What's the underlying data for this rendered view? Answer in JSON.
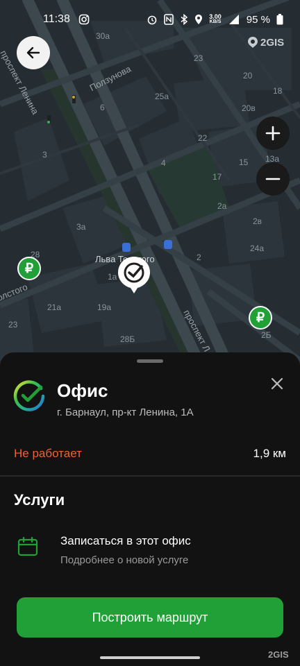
{
  "status_bar": {
    "time": "11:38",
    "network_speed": "3.00",
    "network_unit": "KB/S",
    "battery": "95 %"
  },
  "map": {
    "logo": "2GIS",
    "streets": [
      "проспект Ленина",
      "Ползунова",
      "Толстого",
      "проспект Л"
    ],
    "house_numbers": [
      "30а",
      "23",
      "20",
      "6",
      "25а",
      "20в",
      "18",
      "22",
      "13а",
      "3",
      "4",
      "15",
      "17",
      "2а",
      "3а",
      "2в",
      "24а",
      "28",
      "2",
      "1а",
      "21а",
      "19а",
      "23",
      "28Б",
      "2Б"
    ],
    "stop_label": "Льва Толстого",
    "atm_symbol": "₽"
  },
  "sheet": {
    "title": "Офис",
    "address": "г. Барнаул, пр-кт Ленина, 1А",
    "status": "Не работает",
    "distance": "1,9 км",
    "services_heading": "Услуги",
    "service_title": "Записаться в этот офис",
    "service_subtitle": "Подробнее о новой услуге",
    "route_button": "Построить маршрут",
    "watermark": "2GIS"
  },
  "colors": {
    "accent_green": "#21a038",
    "status_closed": "#f0612d",
    "map_background": "#252d33",
    "sheet_background": "#121212"
  },
  "icons": [
    "instagram-icon",
    "alarm-icon",
    "nfc-icon",
    "bluetooth-icon",
    "location-icon",
    "network-4g-icon",
    "battery-icon",
    "back-arrow-icon",
    "plus-icon",
    "minus-icon",
    "sber-check-icon",
    "close-icon",
    "calendar-icon",
    "bus-stop-icon",
    "ruble-icon"
  ]
}
